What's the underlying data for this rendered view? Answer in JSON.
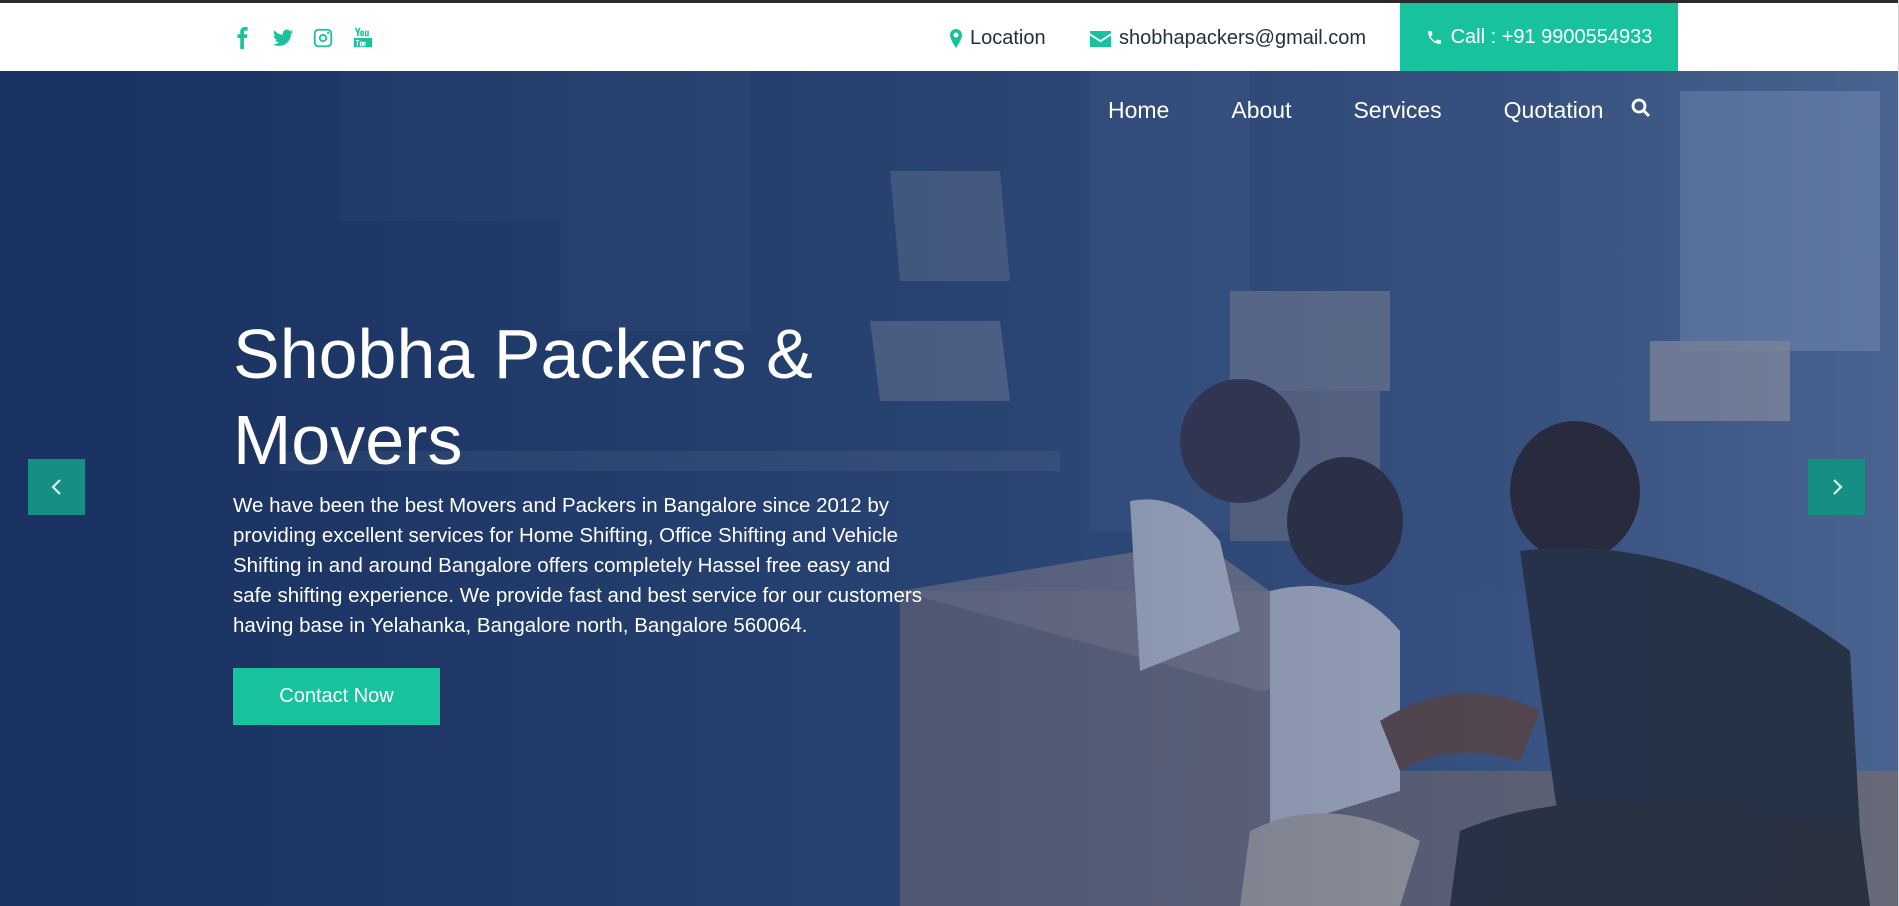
{
  "topbar": {
    "social_icons": [
      "facebook-icon",
      "twitter-icon",
      "instagram-icon",
      "youtube-icon"
    ],
    "location_label": "Location",
    "email": "shobhapackers@gmail.com",
    "call_label": "Call : +91 9900554933"
  },
  "nav": {
    "items": [
      {
        "label": "Home"
      },
      {
        "label": "About"
      },
      {
        "label": "Services"
      },
      {
        "label": "Quotation"
      }
    ],
    "search_icon": "search-icon"
  },
  "hero": {
    "title": "Shobha Packers & Movers",
    "description": "We have been the best Movers and Packers in Bangalore since 2012 by providing excellent services for Home Shifting, Office Shifting and Vehicle Shifting in and around Bangalore offers completely Hassel free easy and safe shifting experience. We provide fast and best service for our customers having base in Yelahanka, Bangalore north, Bangalore 560064.",
    "cta_label": "Contact Now",
    "prev_icon": "chevron-left-icon",
    "next_icon": "chevron-right-icon"
  },
  "colors": {
    "accent": "#18c29c",
    "hero_overlay": "#1d3765",
    "arrow_bg": "#168e82"
  }
}
